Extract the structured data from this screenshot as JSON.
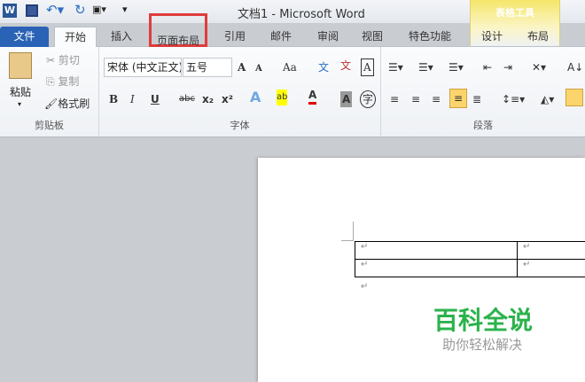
{
  "window": {
    "title": "文档1 - Microsoft Word",
    "app_icon": "W"
  },
  "contextual": {
    "label": "表格工具",
    "color": "#f5e66a"
  },
  "tabs": {
    "file": "文件",
    "home": "开始",
    "insert": "插入",
    "layout": "页面布局",
    "references": "引用",
    "mailings": "邮件",
    "review": "审阅",
    "view": "视图",
    "special": "特色功能",
    "design": "设计",
    "table_layout": "布局"
  },
  "highlight_color": "#e03c3c",
  "clipboard": {
    "paste": "粘贴",
    "cut": "剪切",
    "copy": "复制",
    "format_painter": "格式刷",
    "label": "剪贴板"
  },
  "font": {
    "name": "宋体 (中文正文)",
    "size": "五号",
    "label": "字体",
    "bold": "B",
    "italic": "I",
    "underline": "U",
    "strike": "abc",
    "sub": "x₂",
    "sup": "x²",
    "grow": "A",
    "shrink": "A",
    "case": "Aa",
    "clear": "A"
  },
  "paragraph": {
    "label": "段落"
  },
  "document": {
    "mark": "↵"
  },
  "watermark": {
    "title": "百科全说",
    "subtitle": "助你轻松解决"
  }
}
